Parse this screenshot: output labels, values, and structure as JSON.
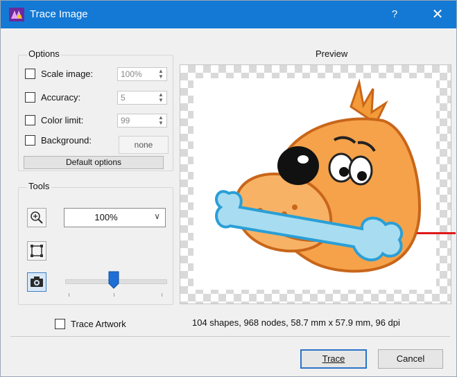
{
  "window": {
    "title": "Trace Image",
    "help_glyph": "?",
    "close_glyph": "✕"
  },
  "options": {
    "group_label": "Options",
    "scale_image": {
      "label": "Scale image:",
      "value": "100%",
      "checked": false
    },
    "accuracy": {
      "label": "Accuracy:",
      "value": "5",
      "checked": false
    },
    "color_limit": {
      "label": "Color limit:",
      "value": "99",
      "checked": false
    },
    "background": {
      "label": "Background:",
      "button_label": "none",
      "checked": false
    },
    "default_button": "Default options"
  },
  "tools": {
    "group_label": "Tools",
    "zoom_value": "100%",
    "slider_position_pct": 45,
    "icons": [
      "zoom-in-icon",
      "crop-frame-icon",
      "camera-icon"
    ]
  },
  "preview": {
    "label": "Preview"
  },
  "footer": {
    "trace_artwork_label": "Trace Artwork",
    "trace_artwork_checked": false,
    "stats": "104 shapes, 968 nodes, 58.7 mm x 57.9 mm, 96 dpi",
    "trace_button": "Trace",
    "cancel_button": "Cancel"
  },
  "colors": {
    "titlebar": "#1479d4",
    "accent": "#2a73c8",
    "slider_thumb": "#1d6fd6"
  }
}
